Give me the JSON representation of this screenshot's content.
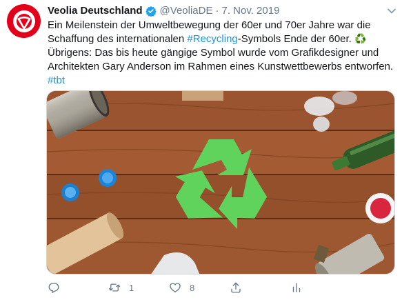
{
  "tweet": {
    "author": {
      "display_name": "Veolia Deutschland",
      "handle": "@VeoliaDE",
      "avatar_icon": "veolia-logo-icon",
      "brand_color": "#e2001a"
    },
    "separator": "·",
    "date": "7. Nov. 2019",
    "text": {
      "part1": "Ein Meilenstein der Umweltbewegung der 60er und 70er Jahre war die Schaffung des internationalen ",
      "hashtag1": "#Recycling",
      "part2": "-Symbols Ende der 60er. ",
      "emoji": "♻️",
      "part3": " Übrigens: Das bis heute gängige Symbol wurde vom Grafikdesigner und Architekten Gary Anderson im Rahmen eines Kunstwettbewerbs entworfen. ",
      "hashtag2": "#tbt"
    },
    "media": {
      "icon": "recycling-symbol-icon",
      "accent_color": "#5fd35b"
    },
    "actions": {
      "reply_count": "",
      "retweet_count": "1",
      "like_count": "8"
    },
    "colors": {
      "link": "#1b95e0",
      "muted": "#657786",
      "verified": "#1da1f2"
    }
  }
}
